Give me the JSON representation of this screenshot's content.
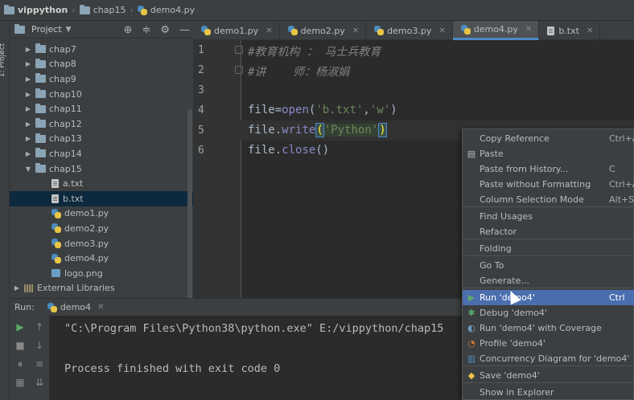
{
  "breadcrumb": {
    "project": "vippython",
    "folder": "chap15",
    "file": "demo4.py"
  },
  "tool_stripe": {
    "project_label": "1: Project",
    "structure_label": "ucture"
  },
  "project_panel": {
    "title": "Project",
    "tree": [
      {
        "label": "chap7",
        "kind": "folder",
        "expanded": false
      },
      {
        "label": "chap8",
        "kind": "folder",
        "expanded": false
      },
      {
        "label": "chap9",
        "kind": "folder",
        "expanded": false
      },
      {
        "label": "chap10",
        "kind": "folder",
        "expanded": false
      },
      {
        "label": "chap11",
        "kind": "folder",
        "expanded": false
      },
      {
        "label": "chap12",
        "kind": "folder",
        "expanded": false
      },
      {
        "label": "chap13",
        "kind": "folder",
        "expanded": false
      },
      {
        "label": "chap14",
        "kind": "folder",
        "expanded": false
      },
      {
        "label": "chap15",
        "kind": "folder",
        "expanded": true
      },
      {
        "label": "a.txt",
        "kind": "txt"
      },
      {
        "label": "b.txt",
        "kind": "txt",
        "selected": true
      },
      {
        "label": "demo1.py",
        "kind": "py"
      },
      {
        "label": "demo2.py",
        "kind": "py"
      },
      {
        "label": "demo3.py",
        "kind": "py"
      },
      {
        "label": "demo4.py",
        "kind": "py"
      },
      {
        "label": "logo.png",
        "kind": "img"
      },
      {
        "label": "External Libraries",
        "kind": "lib",
        "expanded": false
      }
    ]
  },
  "editor_tabs": [
    {
      "label": "demo1.py",
      "icon": "python-file-icon",
      "active": false
    },
    {
      "label": "demo2.py",
      "icon": "python-file-icon",
      "active": false
    },
    {
      "label": "demo3.py",
      "icon": "python-file-icon",
      "active": false
    },
    {
      "label": "demo4.py",
      "icon": "python-file-icon",
      "active": true
    },
    {
      "label": "b.txt",
      "icon": "text-file-icon",
      "active": false
    }
  ],
  "editor": {
    "line_numbers": [
      "1",
      "2",
      "3",
      "4",
      "5",
      "6"
    ],
    "current_line": "5",
    "comment_1": "#教育机构 ： 马士兵教育",
    "comment_2": "#讲    师：杨淑娟",
    "code4": {
      "var": "file",
      "eq": "=",
      "fn": "open",
      "open": "(",
      "arg1": "'b.txt'",
      "comma": ",",
      "arg2": "'w'",
      "close": ")"
    },
    "code5": {
      "prefix": "file.",
      "fn": "write",
      "open": "(",
      "arg": "'Python'",
      "close": ")"
    },
    "code6": {
      "prefix": "file.",
      "fn": "close",
      "rest": "()"
    }
  },
  "run_panel": {
    "label": "Run:",
    "tab": "demo4",
    "line1": "\"C:\\Program Files\\Python38\\python.exe\" E:/vippython/chap15",
    "line2": "Process finished with exit code 0"
  },
  "context_menu": {
    "items": [
      {
        "label": "Copy Reference",
        "shortcut": "Ctrl+A"
      },
      {
        "label": "Paste",
        "shortcut": "",
        "icon": "paste-icon"
      },
      {
        "label": "Paste from History...",
        "shortcut": "C"
      },
      {
        "label": "Paste without Formatting",
        "shortcut": "Ctrl+A"
      },
      {
        "label": "Column Selection Mode",
        "shortcut": "Alt+S"
      },
      {
        "label": "Find Usages",
        "shortcut": ""
      },
      {
        "label": "Refactor",
        "shortcut": ""
      },
      {
        "label": "Folding",
        "shortcut": ""
      },
      {
        "label": "Go To",
        "shortcut": ""
      },
      {
        "label": "Generate...",
        "shortcut": ""
      },
      {
        "label": "Run 'demo4'",
        "shortcut": "Ctrl",
        "icon": "run-icon",
        "highlighted": true
      },
      {
        "label": "Debug 'demo4'",
        "shortcut": "",
        "icon": "debug-icon"
      },
      {
        "label": "Run 'demo4' with Coverage",
        "shortcut": "",
        "icon": "coverage-icon"
      },
      {
        "label": "Profile 'demo4'",
        "shortcut": "",
        "icon": "profile-icon"
      },
      {
        "label": "Concurrency Diagram for 'demo4'",
        "shortcut": "",
        "icon": "concurrency-icon"
      },
      {
        "label": "Save 'demo4'",
        "shortcut": "",
        "icon": "python-icon"
      },
      {
        "label": "Show in Explorer",
        "shortcut": ""
      }
    ]
  },
  "colors": {
    "accent": "#4b6eaf",
    "selection": "#0d293e",
    "tab_underline": "#4a88c7"
  }
}
